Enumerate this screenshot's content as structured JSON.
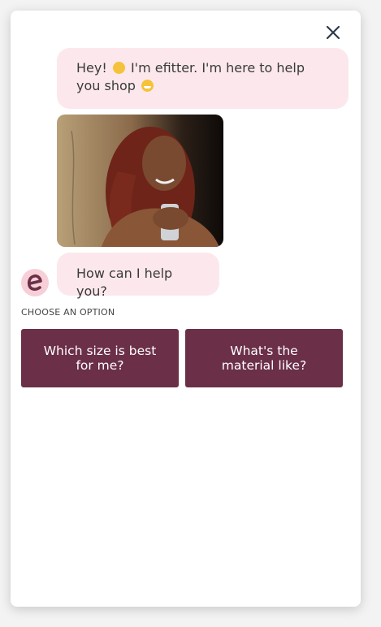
{
  "chat": {
    "greeting_part1": "Hey!",
    "greeting_part2": "I'm efitter. I'm here to help you shop",
    "help_prompt": "How can I help you?"
  },
  "section_label": "CHOOSE AN OPTION",
  "options": [
    {
      "label": "Which size is best for me?"
    },
    {
      "label": "What's the material like?"
    }
  ],
  "icons": {
    "close": "close-icon",
    "avatar_letter": "e",
    "wave": "waving-hand-emoji",
    "grin": "grinning-emoji"
  },
  "colors": {
    "bubble": "#fce8ec",
    "option_button": "#6b2f47",
    "avatar_bg": "#f7cfd8",
    "avatar_fg": "#6b2f47"
  }
}
